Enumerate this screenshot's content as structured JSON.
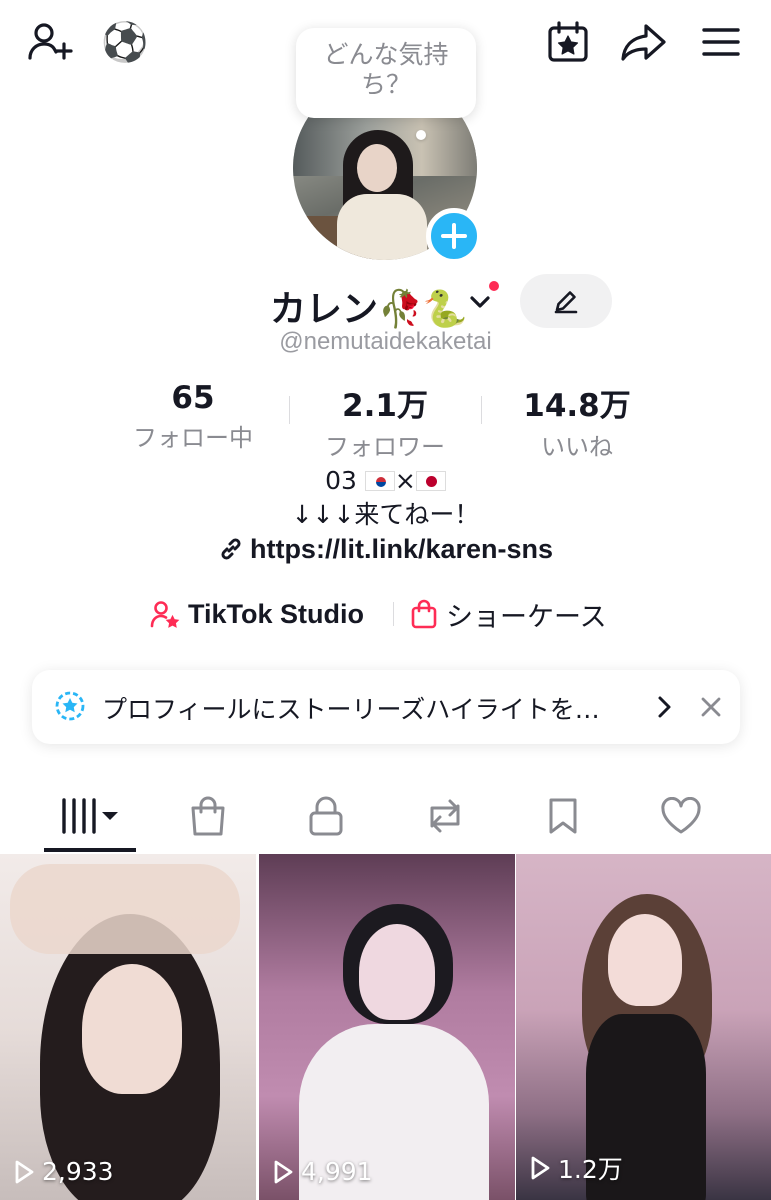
{
  "topbar": {
    "icons": [
      "add-friend-icon",
      "soccer-ball-icon",
      "calendar-star-icon",
      "share-icon",
      "menu-icon"
    ],
    "ball_emoji": "⚽"
  },
  "profile": {
    "mood_prompt": "どんな気持ち？",
    "display_name": "カレン🥀🐍",
    "handle": "@nemutaidekaketai"
  },
  "stats": {
    "following": {
      "value": "65",
      "label": "フォロー中"
    },
    "followers": {
      "value": "2.1万",
      "label": "フォロワー"
    },
    "likes": {
      "value": "14.8万",
      "label": "いいね"
    }
  },
  "bio": {
    "line1_prefix": "03",
    "line1_sep": "×",
    "line2": "↓↓↓来てねー！",
    "link": "https://lit.link/karen-sns"
  },
  "tools": {
    "studio": "TikTok Studio",
    "showcase": "ショーケース"
  },
  "banner": {
    "text": "プロフィールにストーリーズハイライトを…"
  },
  "tabs": [
    "videos-grid-icon",
    "shopping-bag-icon",
    "lock-icon",
    "repost-icon",
    "bookmark-icon",
    "heart-icon"
  ],
  "videos": [
    {
      "views": "2,933"
    },
    {
      "views": "4,991"
    },
    {
      "views": "1.2万"
    }
  ],
  "colors": {
    "accent": "#fe2c55",
    "add_button": "#29b6f6",
    "text_primary": "#161823",
    "text_secondary": "#8a8b91"
  }
}
